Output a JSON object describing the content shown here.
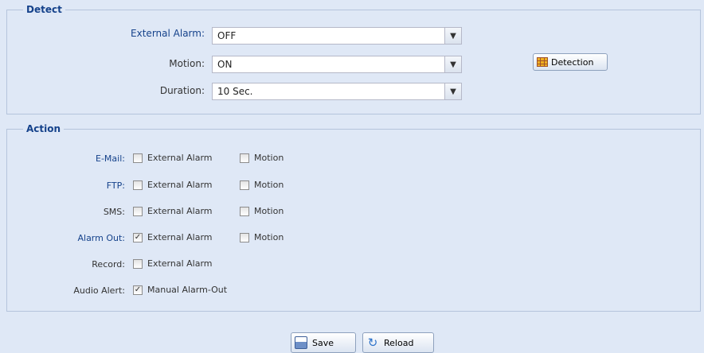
{
  "detect": {
    "legend": "Detect",
    "rows": [
      {
        "label": "External Alarm:",
        "value": "OFF",
        "color": "blue"
      },
      {
        "label": "Motion:",
        "value": "ON",
        "color": "gray"
      },
      {
        "label": "Duration:",
        "value": "10 Sec.",
        "color": "gray"
      }
    ],
    "detection_button": "Detection"
  },
  "action": {
    "legend": "Action",
    "rows": [
      {
        "label": "E-Mail:",
        "opt1": "External Alarm",
        "opt1_checked": false,
        "opt2": "Motion",
        "opt2_checked": false
      },
      {
        "label": "FTP:",
        "opt1": "External Alarm",
        "opt1_checked": false,
        "opt2": "Motion",
        "opt2_checked": false
      },
      {
        "label": "SMS:",
        "opt1": "External Alarm",
        "opt1_checked": false,
        "opt2": "Motion",
        "opt2_checked": false
      },
      {
        "label": "Alarm Out:",
        "opt1": "External Alarm",
        "opt1_checked": true,
        "opt2": "Motion",
        "opt2_checked": false
      },
      {
        "label": "Record:",
        "opt1": "External Alarm",
        "opt1_checked": false
      },
      {
        "label": "Audio Alert:",
        "opt1": "Manual Alarm-Out",
        "opt1_checked": true
      }
    ]
  },
  "footer": {
    "save_label": "Save",
    "reload_label": "Reload"
  },
  "colors": {
    "label_blue": "#15428b",
    "background": "#dfe8f6"
  }
}
